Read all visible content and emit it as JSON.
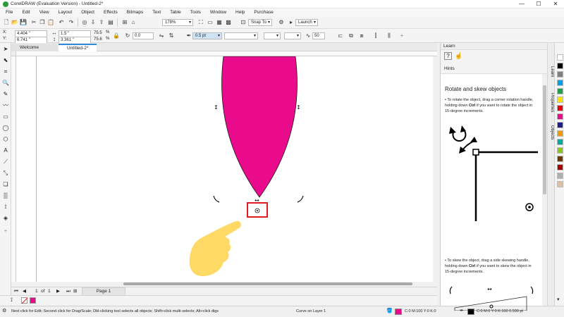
{
  "window": {
    "title": "CorelDRAW (Evaluation Version) - Untitled-2*",
    "minimize": "—",
    "maximize": "☐",
    "close": "✕"
  },
  "menu": [
    "File",
    "Edit",
    "View",
    "Layout",
    "Object",
    "Effects",
    "Bitmaps",
    "Text",
    "Table",
    "Tools",
    "Window",
    "Help",
    "Purchase"
  ],
  "toolbar": {
    "zoom": "178%",
    "snap_to": "Snap To",
    "launch": "Launch"
  },
  "property_bar": {
    "x": "4.404 \"",
    "y": "6.741 \"",
    "width": "1.5 \"",
    "height": "3.361 \"",
    "scale_x": "75.5",
    "scale_y": "75.6",
    "rotation": "0.0",
    "outline_width": "0.5 pt",
    "smoothing": "50"
  },
  "document_tabs": [
    {
      "label": "Welcome Screen",
      "active": false
    },
    {
      "label": "Untitled-2*",
      "active": true
    }
  ],
  "page_navigator": {
    "current": "1",
    "of": "of",
    "total": "1",
    "page_tab": "Page 1"
  },
  "status": {
    "hint": "Next click for Edit; Second click for Drag/Scale; Dbl-clicking tool selects all objects; Shift+click multi-selects; Alt+click digs",
    "layer": "Curve on Layer 1",
    "fill_info": "C:0 M:100 Y:0 K:0",
    "outline_info": "C:0 M:0 Y:0 K:100  0.500 pt"
  },
  "learn_panel": {
    "header": "Learn",
    "hints_label": "Hints",
    "heading": "Rotate and skew objects",
    "bullet1_a": "To rotate the object, drag a corner rotation handle, holding down ",
    "bullet1_ctrl": "Ctrl",
    "bullet1_b": " if you want to rotate the object in 15-degree increments.",
    "bullet2_a": "To skew the object, drag a side skewing handle, holding down ",
    "bullet2_ctrl": "Ctrl",
    "bullet2_b": " if you want to skew the object in 15-degree increments."
  },
  "side_tabs": [
    "Learn",
    "Properties",
    "Objects"
  ],
  "colors": {
    "fill": "#ea0a8c",
    "highlight_box": "#e01b1b",
    "hand": "#ffd966"
  },
  "palette_colors": [
    "#ffffff",
    "#000000",
    "#808080",
    "#00a0e9",
    "#1aa34a",
    "#ffe000",
    "#e60012",
    "#ea0a8c",
    "#1d2088",
    "#f39800",
    "#00a99d",
    "#8fc31f",
    "#6a3906",
    "#a40000",
    "#b0b0b0",
    "#e0c0a0"
  ]
}
